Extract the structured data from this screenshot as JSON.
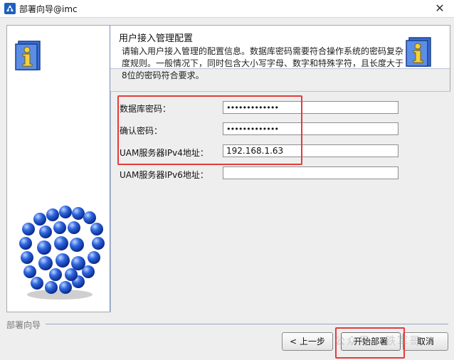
{
  "window": {
    "title": "部署向导@imc",
    "close_glyph": "✕"
  },
  "header": {
    "title": "用户接入管理配置",
    "description": "请输入用户接入管理的配置信息。数据库密码需要符合操作系统的密码复杂度规则。一般情况下，同时包含大小写字母、数字和特殊字符，且长度大于8位的密码符合要求。"
  },
  "form": {
    "fields": [
      {
        "label": "数据库密码：",
        "value": "•••••••••••••"
      },
      {
        "label": "确认密码：",
        "value": "•••••••••••••"
      },
      {
        "label": "UAM服务器IPv4地址：",
        "value": "192.168.1.63"
      },
      {
        "label": "UAM服务器IPv6地址：",
        "value": ""
      }
    ]
  },
  "footer": {
    "group_label": "部署向导",
    "back_button": "< 上一步",
    "start_button": "开始部署",
    "cancel_button": "取消",
    "watermark": "公众号 · 铁军哥"
  },
  "colors": {
    "highlight": "#e33b3b",
    "accent": "#2e5fbf"
  },
  "icons": [
    "app-icon",
    "info-icon",
    "molecule-cube-image",
    "close-icon"
  ]
}
